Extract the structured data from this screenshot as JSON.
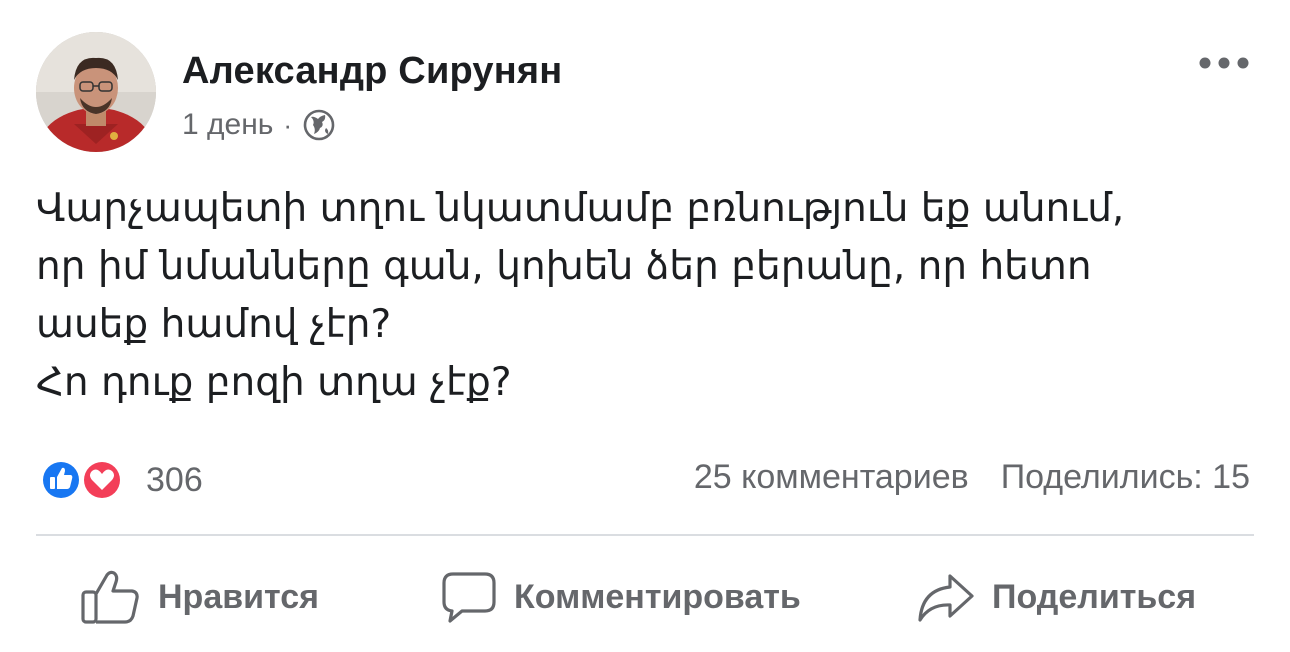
{
  "post": {
    "author": {
      "name": "Александр Сирунян",
      "avatar_icon": "profile-photo"
    },
    "timestamp": "1 день",
    "separator": "·",
    "privacy_icon": "globe-icon",
    "more_icon": "more-options-icon",
    "text_lines": [
      "Վարչապետի տղու նկատմամբ բռնություն եք անում,",
      "որ իմ նմանները գան, կոխեն ձեր բերանը, որ հետո",
      "ասեք համով չէր?",
      "Հո դուք բոզի տղա չէք?"
    ],
    "reactions": {
      "types": [
        "like",
        "love"
      ],
      "count": "306",
      "colors": {
        "like": "#1877f2",
        "love": "#f33e58"
      }
    },
    "comments_label": "25 комментариев",
    "shares_label": "Поделились: 15"
  },
  "actions": {
    "like_label": "Нравится",
    "comment_label": "Комментировать",
    "share_label": "Поделиться"
  },
  "colors": {
    "text": "#1c1e21",
    "secondary": "#65676b",
    "divider": "#dadde1"
  }
}
